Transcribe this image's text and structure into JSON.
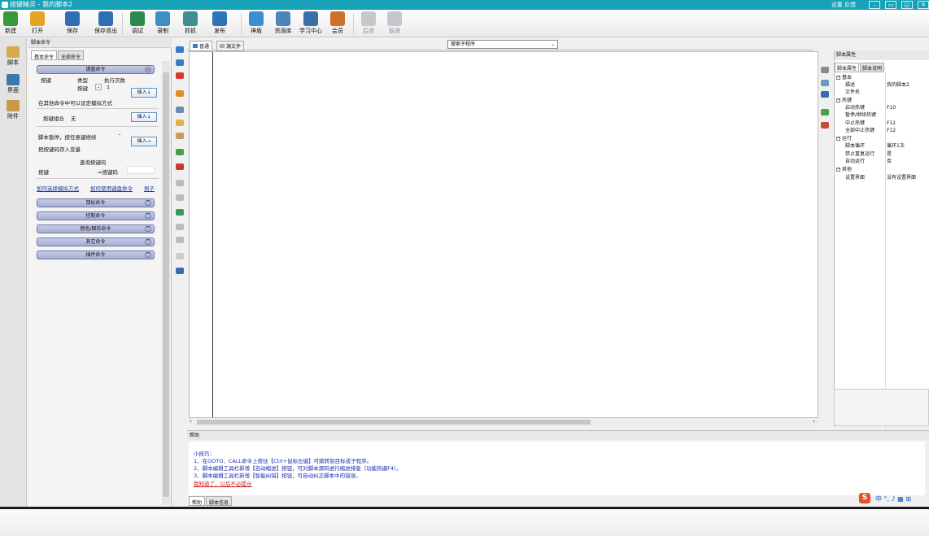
{
  "window": {
    "title": "按键精灵 - 我的脚本2",
    "right_links": "设置 反馈"
  },
  "toolbar": {
    "items": [
      {
        "label": "新建",
        "icon": "new-icon",
        "color": "#3a9a3a"
      },
      {
        "label": "打开",
        "icon": "open-icon",
        "color": "#e6a423"
      },
      {
        "label": "保存",
        "icon": "save-icon",
        "color": "#2f6db5"
      },
      {
        "label": "保存退出",
        "icon": "save-exit-icon",
        "color": "#2f6db5"
      },
      {
        "label": "调试",
        "icon": "debug-icon",
        "color": "#2d8a4a"
      },
      {
        "label": "录制",
        "icon": "record-icon",
        "color": "#3e8fc4"
      },
      {
        "label": "抓抓",
        "icon": "capture-icon",
        "color": "#3e8f8f"
      },
      {
        "label": "发布",
        "icon": "publish-icon",
        "color": "#2f74b8"
      },
      {
        "label": "神盾",
        "icon": "shield-icon",
        "color": "#3b8fd0"
      },
      {
        "label": "资源库",
        "icon": "library-icon",
        "color": "#4a86b8"
      },
      {
        "label": "学习中心",
        "icon": "learning-icon",
        "color": "#3a6fa8"
      },
      {
        "label": "会员",
        "icon": "member-icon",
        "color": "#d0702a"
      },
      {
        "label": "后退",
        "icon": "back-icon",
        "color": "#9aa0a8"
      },
      {
        "label": "前进",
        "icon": "forward-icon",
        "color": "#9aa0a8"
      }
    ]
  },
  "leftnav": [
    {
      "label": "脚本"
    },
    {
      "label": "界面"
    },
    {
      "label": "附件"
    }
  ],
  "cmdpanel": {
    "header": "脚本命令",
    "tabs": [
      "基本命令",
      "全部命令"
    ],
    "keyboard_cmd": "键盘命令",
    "col_key": "按键",
    "col_type": "类型",
    "col_count": "执行次数",
    "type_value": "按键",
    "count_value": "1",
    "insert_label": "插入↓",
    "note_other": "在其他命令中可以设定模拟方式",
    "combo_label": "按键组合",
    "combo_value": "无",
    "wait_label": "脚本暂停，按任意键继续",
    "save_key_var": "把按键码存入变量",
    "insert_arrow": "插入→",
    "query_code": "查询按键码",
    "key_label": "按键",
    "key_code_label": "=按键码",
    "links": [
      "如何选择模拟方式",
      "如何使用键盘命令",
      "例子"
    ],
    "groups": [
      "鼠标命令",
      "控制命令",
      "颜色/图形命令",
      "其它命令",
      "插件命令"
    ]
  },
  "editor": {
    "tabs": [
      "普通",
      "源文件"
    ],
    "search_placeholder": "搜索子程序"
  },
  "help": {
    "header": "帮助",
    "title": "小技巧：",
    "lines": [
      "1、在GOTO、CALL命令上按住【Ctrl+鼠标左键】可跳转到目标或子程序。",
      "2、脚本编辑工具栏新增【自动缩进】按钮，可对脚本源码进行缩进排版（功能热键F4）。",
      "3、脚本编辑工具栏新增【智能纠错】按钮，可自动纠正脚本中的错误。"
    ],
    "dismiss": "我知道了，以后不必提示",
    "tabs": [
      "帮助",
      "脚本信息"
    ]
  },
  "props": {
    "header": "脚本属性",
    "tabs": [
      "脚本属性",
      "脚本说明"
    ],
    "rows": [
      {
        "cat": true,
        "k": "基本",
        "v": ""
      },
      {
        "k": "描述",
        "v": "我的脚本2"
      },
      {
        "k": "文件名",
        "v": ""
      },
      {
        "cat": true,
        "k": "热键",
        "v": ""
      },
      {
        "k": "启动热键",
        "v": "F10"
      },
      {
        "k": "暂停/继续热键",
        "v": ""
      },
      {
        "k": "中止热键",
        "v": "F12"
      },
      {
        "k": "全部中止热键",
        "v": "F12"
      },
      {
        "cat": true,
        "k": "运行",
        "v": ""
      },
      {
        "k": "脚本循环",
        "v": "循环1次"
      },
      {
        "k": "禁止重复运行",
        "v": "是"
      },
      {
        "k": "自动运行",
        "v": "否"
      },
      {
        "cat": true,
        "k": "其他",
        "v": ""
      },
      {
        "k": "设置界面",
        "v": "没有设置界面"
      }
    ]
  },
  "ime": {
    "label": "中 °, ♪ ▦ ⊞"
  }
}
